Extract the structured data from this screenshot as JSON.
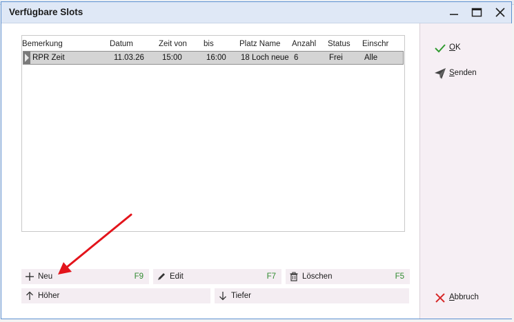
{
  "window": {
    "title": "Verfügbare Slots"
  },
  "grid": {
    "columns": [
      "Bemerkung",
      "Datum",
      "Zeit von",
      "bis",
      "Platz Name",
      "Anzahl",
      "Status",
      "Einschr"
    ],
    "rows": [
      {
        "bemerkung": "RPR Zeit",
        "datum": "11.03.26",
        "zeit_von": "15:00",
        "bis": "16:00",
        "platz_name": "18 Loch neue",
        "anzahl": "6",
        "status": "Frei",
        "einschr": "Alle"
      }
    ]
  },
  "buttons": {
    "neu": {
      "label": "Neu",
      "key": "F9"
    },
    "edit": {
      "label": "Edit",
      "key": "F7"
    },
    "loeschen": {
      "label": "Löschen",
      "key": "F5"
    },
    "hoeher": {
      "label": "Höher"
    },
    "tiefer": {
      "label": "Tiefer"
    }
  },
  "side": {
    "ok": {
      "first": "O",
      "rest": "K"
    },
    "senden": {
      "first": "S",
      "rest": "enden"
    },
    "abbruch": {
      "first": "A",
      "rest": "bbruch"
    }
  },
  "colors": {
    "ok_check": "#2f9a2f",
    "cancel_x": "#d62828",
    "annotation_arrow": "#e3141b",
    "key_hint": "#2f8a2f"
  }
}
